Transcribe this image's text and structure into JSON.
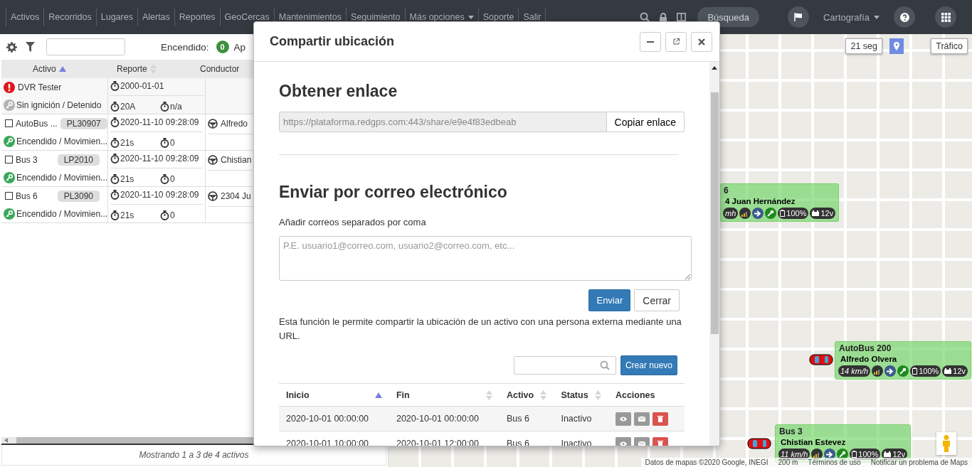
{
  "navbar": {
    "menu": [
      {
        "label": "Activos",
        "dropdown": false
      },
      {
        "label": "Recorridos",
        "dropdown": false
      },
      {
        "label": "Lugares",
        "dropdown": false
      },
      {
        "label": "Alertas",
        "dropdown": false
      },
      {
        "label": "Reportes",
        "dropdown": false
      },
      {
        "label": "GeoCercas",
        "dropdown": false
      },
      {
        "label": "Mantenimientos",
        "dropdown": false
      },
      {
        "label": "Seguimiento",
        "dropdown": false
      },
      {
        "label": "Más opciones",
        "dropdown": true
      },
      {
        "label": "Soporte",
        "dropdown": false
      },
      {
        "label": "Salir",
        "dropdown": false
      }
    ],
    "search_button": "Búsqueda",
    "map_type": "Cartografía"
  },
  "asset_panel": {
    "status_label": "Encendido:",
    "status_count": "0",
    "status_label_cut": "Ap",
    "columns": [
      {
        "label": "Activo",
        "sortable": true,
        "sorted": true
      },
      {
        "label": "Reporte",
        "sortable": true,
        "sorted": false
      },
      {
        "label": "Conductor",
        "sortable": false
      }
    ],
    "rows": [
      {
        "kind": "alert",
        "name": "DVR Tester",
        "status": "Sin ignición / Detenido",
        "ignition": false,
        "report": "2000-01-01",
        "counter_1": "20A",
        "counter_2": "n/a"
      },
      {
        "kind": "checkbox",
        "checked": false,
        "name": "AutoBus ...",
        "plate": "PL30907",
        "status": "Encendido / Movimien...",
        "ignition": true,
        "report": "2020-11-10 09:28:09",
        "counter_1": "21s",
        "counter_2": "0",
        "driver": "Alfredo"
      },
      {
        "kind": "checkbox",
        "checked": false,
        "name": "Bus 3",
        "plate": "LP2010",
        "status": "Encendido / Movimien...",
        "ignition": true,
        "report": "2020-11-10 09:28:09",
        "counter_1": "21s",
        "counter_2": "0",
        "driver": "Chistian"
      },
      {
        "kind": "checkbox",
        "checked": false,
        "name": "Bus 6",
        "plate": "PL3090",
        "status": "Encendido / Movimien...",
        "ignition": true,
        "report": "2020-11-10 09:28:09",
        "counter_1": "21s",
        "counter_2": "0",
        "driver": "2304 Ju"
      }
    ],
    "footer": "Mostrando 1 a 3 de 4 activos"
  },
  "map": {
    "refresh": "21 seg",
    "traffic": "Tráfico",
    "vehicles": [
      {
        "name": "6",
        "driver": "4 Juan Hernández",
        "speed": "mh",
        "battery": "100%",
        "voltage": "12v",
        "car": false
      },
      {
        "name": "AutoBus 200",
        "driver": "Alfredo Olvera",
        "speed": "14 km/h",
        "battery": "100%",
        "voltage": "12v",
        "car": true
      },
      {
        "name": "Bus 3",
        "driver": "Chistian Estevez",
        "speed": "11 km/h",
        "battery": "100%",
        "voltage": "12v",
        "car": true
      }
    ],
    "attribution": [
      "Datos de mapas ©2020 Google, INEGI",
      "200 m",
      "Términos de uso",
      "Notificar un problema de Maps"
    ]
  },
  "dialog": {
    "title": "Compartir ubicación",
    "link_heading": "Obtener enlace",
    "link_value": "https://plataforma.redgps.com:443/share/e9e4f83edbeab",
    "copy_button": "Copiar enlace",
    "email_heading": "Enviar por correo electrónico",
    "email_label": "Añadir correos separados por coma",
    "email_placeholder": "P.E. usuario1@correo.com, usuario2@correo.com, etc...",
    "send_button": "Enviar",
    "close_button": "Cerrar",
    "description": "Esta función le permite compartir la ubicación de un activo con una persona externa mediante una URL.",
    "create_button": "Crear nuevo",
    "columns": [
      {
        "label": "Inicio",
        "sortable": true,
        "sorted": true
      },
      {
        "label": "Fin",
        "sortable": true,
        "sorted": false
      },
      {
        "label": "Activo",
        "sortable": true,
        "sorted": false
      },
      {
        "label": "Status",
        "sortable": true,
        "sorted": false
      },
      {
        "label": "Acciones",
        "sortable": false
      }
    ],
    "rows": [
      {
        "start": "2020-10-01 00:00:00",
        "end": "2020-10-01 00:00:00",
        "asset": "Bus 6",
        "status": "Inactivo"
      },
      {
        "start": "2020-10-01 10:00:00",
        "end": "2020-10-01 12:00:00",
        "asset": "Bus 6",
        "status": "Inactivo"
      }
    ]
  }
}
